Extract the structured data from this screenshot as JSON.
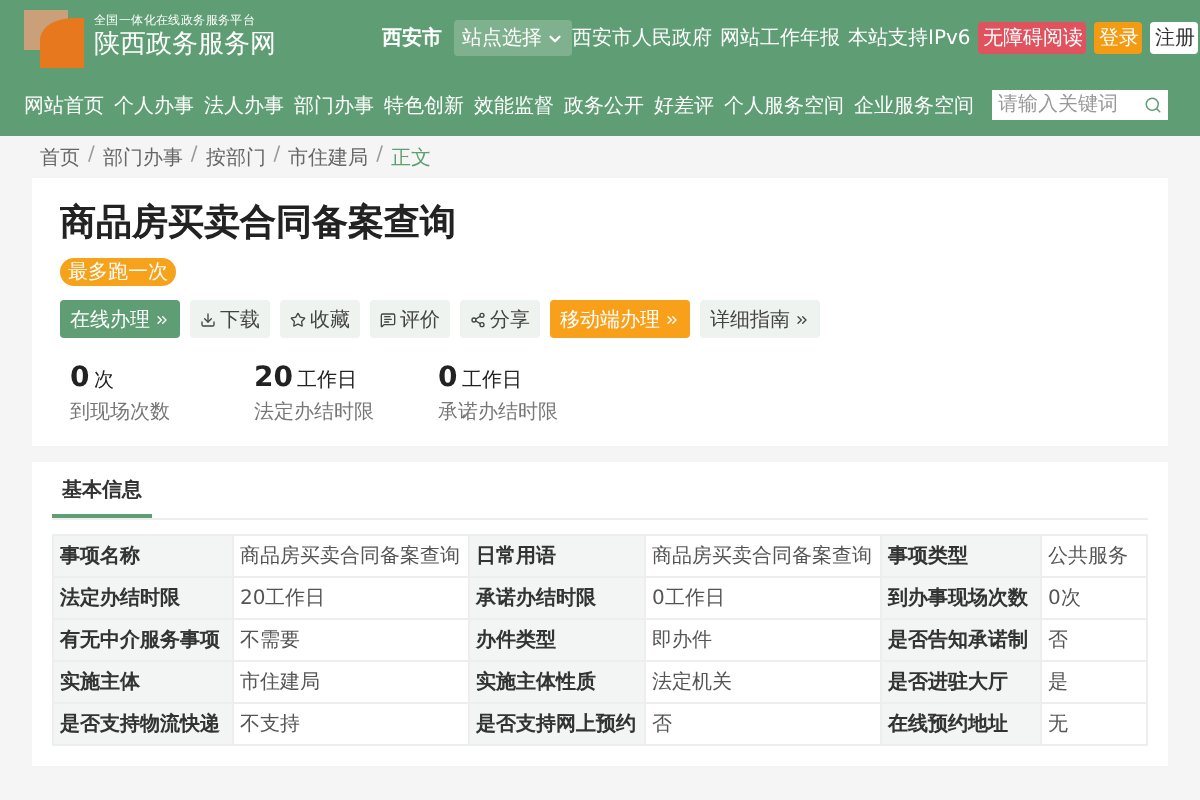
{
  "header": {
    "platform": "全国一体化在线政务服务平台",
    "site_name": "陕西政务服务网",
    "city": "西安市",
    "site_select": "站点选择",
    "links": [
      {
        "label": "西安市人民政府",
        "kind": "plain"
      },
      {
        "label": "网站工作年报",
        "kind": "plain"
      },
      {
        "label": "本站支持IPv6",
        "kind": "plain"
      },
      {
        "label": "无障碍阅读",
        "kind": "red"
      },
      {
        "label": "登录",
        "kind": "orange"
      },
      {
        "label": "注册",
        "kind": "white"
      }
    ]
  },
  "nav": {
    "items": [
      "网站首页",
      "个人办事",
      "法人办事",
      "部门办事",
      "特色创新",
      "效能监督",
      "政务公开",
      "好差评",
      "个人服务空间",
      "企业服务空间"
    ],
    "search": {
      "placeholder": "请输入关键词"
    }
  },
  "breadcrumb": {
    "separator": "/",
    "items": [
      {
        "label": "首页",
        "current": false
      },
      {
        "label": "部门办事",
        "current": false
      },
      {
        "label": "按部门",
        "current": false
      },
      {
        "label": "市住建局",
        "current": false
      },
      {
        "label": "正文",
        "current": true
      }
    ]
  },
  "item": {
    "title": "商品房买卖合同备案查询",
    "tag": "最多跑一次",
    "actions": [
      {
        "label": "在线办理",
        "kind": "primary"
      },
      {
        "label": "下载",
        "kind": "plain"
      },
      {
        "label": "收藏",
        "kind": "plain"
      },
      {
        "label": "评价",
        "kind": "plain"
      },
      {
        "label": "分享",
        "kind": "plain"
      },
      {
        "label": "移动端办理",
        "kind": "accent"
      },
      {
        "label": "详细指南",
        "kind": "plain"
      }
    ],
    "stats": [
      {
        "value": "0",
        "unit": "次",
        "label": "到现场次数"
      },
      {
        "value": "20",
        "unit": "工作日",
        "label": "法定办结时限"
      },
      {
        "value": "0",
        "unit": "工作日",
        "label": "承诺办结时限"
      }
    ]
  },
  "basic_info": {
    "tabs": [
      {
        "label": "基本信息",
        "selected": true
      }
    ],
    "rows": [
      [
        {
          "label": "事项名称",
          "value": "商品房买卖合同备案查询"
        },
        {
          "label": "日常用语",
          "value": "商品房买卖合同备案查询"
        },
        {
          "label": "事项类型",
          "value": "公共服务"
        }
      ],
      [
        {
          "label": "法定办结时限",
          "value": "20工作日"
        },
        {
          "label": "承诺办结时限",
          "value": "0工作日"
        },
        {
          "label": "到办事现场次数",
          "value": "0次"
        }
      ],
      [
        {
          "label": "有无中介服务事项",
          "value": "不需要"
        },
        {
          "label": "办件类型",
          "value": "即办件"
        },
        {
          "label": "是否告知承诺制",
          "value": "否"
        }
      ],
      [
        {
          "label": "实施主体",
          "value": "市住建局"
        },
        {
          "label": "实施主体性质",
          "value": "法定机关"
        },
        {
          "label": "是否进驻大厅",
          "value": "是"
        }
      ],
      [
        {
          "label": "是否支持物流快递",
          "value": "不支持"
        },
        {
          "label": "是否支持网上预约",
          "value": "否"
        },
        {
          "label": "在线预约地址",
          "value": "无"
        }
      ]
    ]
  }
}
